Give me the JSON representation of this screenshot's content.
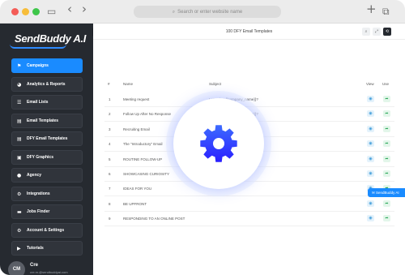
{
  "browser": {
    "url_placeholder": "Search or enter website name",
    "search_glyph": "⌕",
    "sidebar_toggle_glyph": "▭",
    "back_glyph": "‹",
    "forward_glyph": "›",
    "new_tab_glyph": "+",
    "tabs_glyph": "⧉"
  },
  "app": {
    "logo_text": "SendBuddy A.I",
    "page_title": "100 DFY Email Templates",
    "menu_glyph": "≡"
  },
  "sidebar": {
    "items": [
      {
        "label": "Campaigns",
        "icon": "⚑",
        "active": true
      },
      {
        "label": "Analytics & Reports",
        "icon": "◕",
        "active": false
      },
      {
        "label": "Email Lists",
        "icon": "☰",
        "active": false
      },
      {
        "label": "Email Templates",
        "icon": "▤",
        "active": false
      },
      {
        "label": "DFY Email Templates",
        "icon": "▤",
        "active": false
      },
      {
        "label": "DFY Graphics",
        "icon": "▣",
        "active": false
      },
      {
        "label": "Agency",
        "icon": "●",
        "active": false
      },
      {
        "label": "Integrations",
        "icon": "⚙",
        "active": false
      },
      {
        "label": "Jobs Finder",
        "icon": "▬",
        "active": false
      },
      {
        "label": "Account & Settings",
        "icon": "⚙",
        "active": false
      },
      {
        "label": "Tutorials",
        "icon": "▶",
        "active": false
      }
    ],
    "user": {
      "initials": "CM",
      "name": "Cre",
      "email": "cre.m.@sendbuddyai.com"
    }
  },
  "topbar": {
    "btn1_glyph": "⌕",
    "btn2_glyph": "⤢",
    "btn3_glyph": "⟲"
  },
  "table": {
    "headers": {
      "num": "#",
      "name": "Name",
      "subject": "Subject",
      "view": "View",
      "use": "Use"
    },
    "rows": [
      {
        "num": "1",
        "name": "Meeting request",
        "subject": "Let's chat {{company_name}}?"
      },
      {
        "num": "2",
        "name": "Follow Up After No Response",
        "subject": "Let's chat {{company_name}}?"
      },
      {
        "num": "3",
        "name": "Recruiting Email",
        "subject": "...name}}?"
      },
      {
        "num": "4",
        "name": "The \"Introductory\" Email",
        "subject": ""
      },
      {
        "num": "5",
        "name": "ROUTINE FOLLOW-UP",
        "subject": ""
      },
      {
        "num": "6",
        "name": "SHOWCASING CURIOSITY",
        "subject": ""
      },
      {
        "num": "7",
        "name": "IDEAS FOR YOU",
        "subject": ""
      },
      {
        "num": "8",
        "name": "BE UPFRONT",
        "subject": ""
      },
      {
        "num": "9",
        "name": "RESPONDING TO AN ONLINE POST",
        "subject": ""
      }
    ],
    "view_glyph": "◉",
    "use_glyph": "➦"
  },
  "chat": {
    "label": "SendBuddy AI",
    "glyph": "✉"
  },
  "colors": {
    "accent": "#1a8bff",
    "sidebar_bg": "#262a30",
    "gear_top": "#3d6bff",
    "gear_bottom": "#2a1fff"
  }
}
